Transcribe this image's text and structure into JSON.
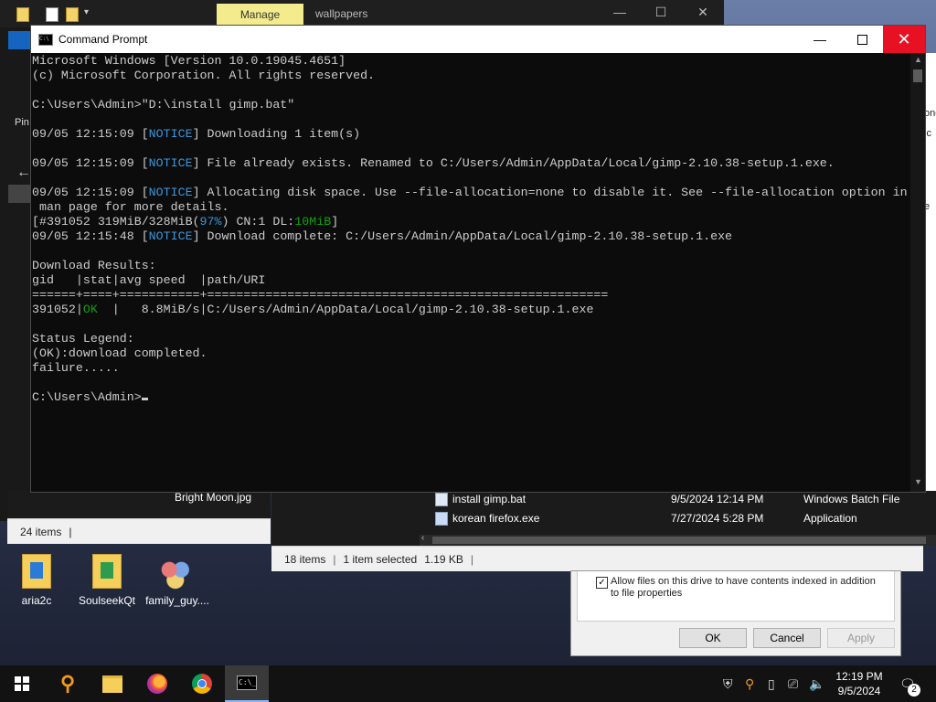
{
  "explorer_bg": {
    "manage_tab": "Manage",
    "title": "wallpapers",
    "left_pin": "Pin",
    "bright_moon_label": "Bright Moon.jpg",
    "items_count": "24 items",
    "files": [
      {
        "name": "install gimp.bat",
        "date": "9/5/2024 12:14 PM",
        "type": "Windows Batch File"
      },
      {
        "name": "korean firefox.exe",
        "date": "7/27/2024 5:28 PM",
        "type": "Application"
      }
    ],
    "status": {
      "items": "18 items",
      "selected": "1 item selected",
      "size": "1.19 KB"
    }
  },
  "right_strip": [
    "one",
    "ic",
    "e"
  ],
  "dialog": {
    "checkbox_label": "Allow files on this drive to have contents indexed in addition to file properties",
    "checked": true,
    "ok": "OK",
    "cancel": "Cancel",
    "apply": "Apply"
  },
  "desktop_icons": [
    {
      "label": "aria2c"
    },
    {
      "label": "SoulseekQt"
    },
    {
      "label": "family_guy...."
    }
  ],
  "cmd": {
    "title": "Command Prompt",
    "lines": {
      "l1": "Microsoft Windows [Version 10.0.19045.4651]",
      "l2": "(c) Microsoft Corporation. All rights reserved.",
      "l3": "C:\\Users\\Admin>\"D:\\install gimp.bat\"",
      "ts": "09/05 12:15:09 [",
      "ts2": "09/05 12:15:48 [",
      "notice": "NOTICE",
      "n1": "] Downloading 1 item(s)",
      "n2": "] File already exists. Renamed to C:/Users/Admin/AppData/Local/gimp-2.10.38-setup.1.exe.",
      "n3": "] Allocating disk space. Use --file-allocation=none to disable it. See --file-allocation option in",
      "n3b": " man page for more details.",
      "prog_a": "[#391052 319MiB/328MiB(",
      "prog_pct": "97%",
      "prog_b": ") CN:1 DL:",
      "prog_dl": "10MiB",
      "prog_c": "]",
      "n4": "] Download complete: C:/Users/Admin/AppData/Local/gimp-2.10.38-setup.1.exe",
      "results": "Download Results:",
      "header": "gid   |stat|avg speed  |path/URI",
      "rule": "======+====+===========+=======================================================",
      "row_gid": "391052|",
      "row_ok": "OK",
      "row_rest": "  |   8.8MiB/s|C:/Users/Admin/AppData/Local/gimp-2.10.38-setup.1.exe",
      "legend": "Status Legend:",
      "legend_ok": "(OK):download completed.",
      "failure": "failure.....",
      "prompt": "C:\\Users\\Admin>"
    }
  },
  "taskbar": {
    "clock_time": "12:19 PM",
    "clock_date": "9/5/2024",
    "notification_count": "2"
  }
}
